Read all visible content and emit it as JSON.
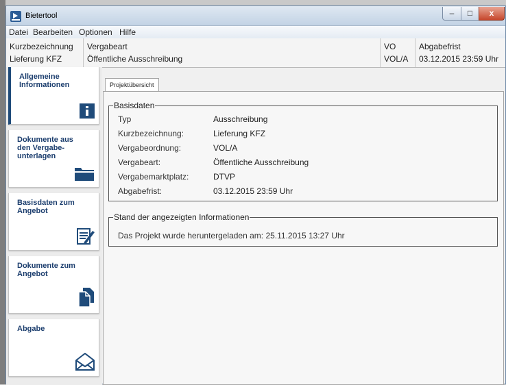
{
  "window": {
    "title": "Bietertool",
    "btn_min": "–",
    "btn_max": "□",
    "btn_close": "x"
  },
  "menu": [
    "Datei",
    "Bearbeiten",
    "Optionen",
    "Hilfe"
  ],
  "header": {
    "kurz_label": "Kurzbezeichnung",
    "kurz_value": "Lieferung KFZ",
    "vergabeart_label": "Vergabeart",
    "vergabeart_value": "Öffentliche Ausschreibung",
    "vo_label": "VO",
    "vo_value": "VOL/A",
    "frist_label": "Abgabefrist",
    "frist_value": "03.12.2015 23:59 Uhr"
  },
  "sidebar": {
    "items": [
      {
        "label": "Allgemeine Informationen",
        "icon": "info-icon"
      },
      {
        "label": "Dokumente aus den Vergabe-unterlagen",
        "icon": "folder-icon"
      },
      {
        "label": "Basisdaten zum Angebot",
        "icon": "edit-document-icon"
      },
      {
        "label": "Dokumente zum Angebot",
        "icon": "documents-icon"
      },
      {
        "label": "Abgabe",
        "icon": "envelope-icon"
      }
    ]
  },
  "tab": {
    "label": "Projektübersicht"
  },
  "basisdaten": {
    "legend": "Basisdaten",
    "rows": [
      {
        "label": "Typ",
        "value": "Ausschreibung"
      },
      {
        "label": "Kurzbezeichnung:",
        "value": "Lieferung KFZ"
      },
      {
        "label": "Vergabeordnung:",
        "value": "VOL/A"
      },
      {
        "label": "Vergabeart:",
        "value": "Öffentliche Ausschreibung"
      },
      {
        "label": "Vergabemarktplatz:",
        "value": "DTVP"
      },
      {
        "label": "Abgabefrist:",
        "value": "03.12.2015 23:59 Uhr"
      }
    ]
  },
  "stand": {
    "legend": "Stand der angezeigten Informationen",
    "text": "Das Projekt wurde heruntergeladen am: 25.11.2015 13:27 Uhr"
  },
  "colors": {
    "nav_text": "#1c3e6e",
    "icon_blue": "#1f4b7a"
  }
}
